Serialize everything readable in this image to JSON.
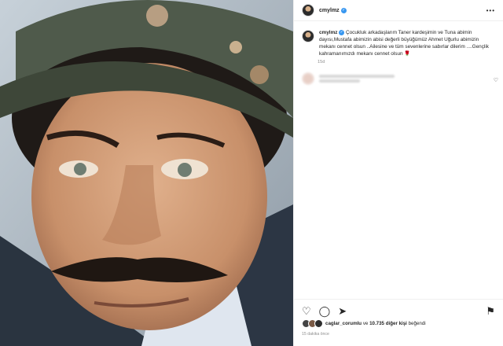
{
  "post": {
    "username": "cmylmz",
    "caption_username": "cmylmz",
    "caption_text": "Çocukluk arkadaşlarım Taner kardeşimin ve Tuna abimin dayısı,Mustafa abimizin abisi değerli büyüğümüz Ahmet Uğurlu abimizin mekanı cennet olsun ..Ailesine ve tüm sevenlerine sabırlar dilerim ....Gençlik kahramanımızdı mekanı cennet olsun",
    "caption_emoji": "🌹",
    "age": "15d",
    "more_label": "•••",
    "verified_label": "✓"
  },
  "likes": {
    "user": "caglar_corumlu",
    "connector": " ve ",
    "others": "10.735 diğer kişi",
    "suffix": " beğendi"
  },
  "time_ago": "15 dakika önce",
  "icons": {
    "heart": "♡",
    "comment": "◯",
    "share": "➤",
    "save": "⚑",
    "comment_like": "♡"
  }
}
